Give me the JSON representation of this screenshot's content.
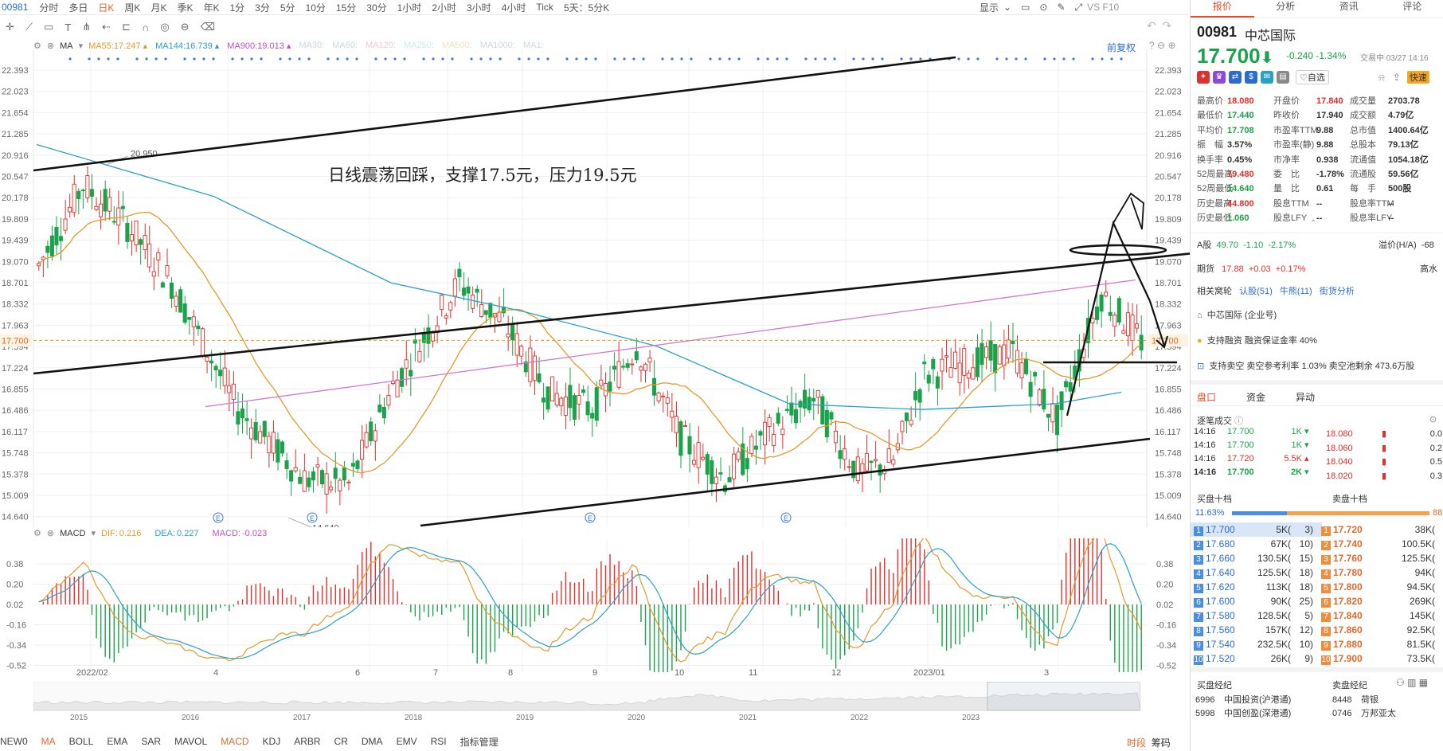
{
  "topbar": {
    "code": "00981",
    "periods": [
      "分时",
      "多日",
      "日K",
      "周K",
      "月K",
      "季K",
      "年K",
      "1分",
      "3分",
      "5分",
      "10分",
      "15分",
      "30分",
      "1小时",
      "2小时",
      "3小时",
      "4小时",
      "Tick",
      "5天：5分K"
    ],
    "active_period": "日K",
    "show_label": "显示",
    "vs_label": "VS F10"
  },
  "main_chart": {
    "indicator_name": "MA",
    "ma_items": [
      {
        "label": "MA55:",
        "value": "17.247",
        "color": "#e39a2c"
      },
      {
        "label": "MA144:",
        "value": "16.739",
        "color": "#2aa0c8"
      },
      {
        "label": "MA900:",
        "value": "19.013",
        "color": "#c050c0"
      },
      {
        "label": "MA30:",
        "value": "",
        "color": "#c8d8e8"
      },
      {
        "label": "MA60:",
        "value": "",
        "color": "#c8d8e8"
      },
      {
        "label": "MA120:",
        "value": "",
        "color": "#f0c8d8"
      },
      {
        "label": "MA250:",
        "value": "",
        "color": "#c8e8f0"
      },
      {
        "label": "MA500:",
        "value": "",
        "color": "#f0e0c0"
      },
      {
        "label": "MA1000:",
        "value": "",
        "color": "#c8d8e8"
      },
      {
        "label": "MA1:",
        "value": "",
        "color": "#c8d8e8"
      }
    ],
    "fq_label": "前复权",
    "annotation": "日线震荡回踩，支撑17.5元，压力19.5元",
    "high_label": "20.950",
    "low_label": "14.640",
    "current_price_tag": "17.700",
    "y_ticks": [
      "22.393",
      "22.023",
      "21.654",
      "21.285",
      "20.916",
      "20.547",
      "20.178",
      "19.809",
      "19.439",
      "19.070",
      "18.701",
      "18.332",
      "17.963",
      "17.594",
      "17.224",
      "16.855",
      "16.486",
      "16.117",
      "15.748",
      "15.378",
      "15.009",
      "14.640"
    ],
    "event_marker": "E"
  },
  "macd": {
    "name": "MACD",
    "dif_label": "DIF:",
    "dif_value": "0.216",
    "dea_label": "DEA:",
    "dea_value": "0.227",
    "macd_label": "MACD:",
    "macd_value": "-0.023",
    "y_ticks": [
      "0.38",
      "0.20",
      "0.02",
      "-0.16",
      "-0.34",
      "-0.52"
    ]
  },
  "x_axis": {
    "labels": [
      "2022/02",
      "4",
      "6",
      "7",
      "8",
      "9",
      "10",
      "11",
      "12",
      "2023/01",
      "3"
    ]
  },
  "overview": {
    "years": [
      "2015",
      "2016",
      "2017",
      "2018",
      "2019",
      "2020",
      "2021",
      "2022",
      "2023"
    ]
  },
  "bottom_tabs": {
    "items": [
      "NEW0",
      "MA",
      "BOLL",
      "EMA",
      "SAR",
      "MAVOL",
      "MACD",
      "KDJ",
      "ARBR",
      "CR",
      "DMA",
      "EMV",
      "RSI",
      "指标管理"
    ],
    "active": [
      "MA",
      "MACD"
    ],
    "right_items": [
      "时段",
      "筹码"
    ]
  },
  "quote": {
    "tabs": [
      "报价",
      "分析",
      "资讯",
      "评论"
    ],
    "code": "00981",
    "name": "中芯国际",
    "price": "17.700",
    "change": "-0.240",
    "pct": "-1.34%",
    "trade_status": "交易中 03/27 14:16",
    "add_watch": "自选",
    "quick_trade": "快速",
    "stats": [
      [
        "最高价",
        "18.080",
        "red"
      ],
      [
        "开盘价",
        "17.840",
        "red"
      ],
      [
        "成交量",
        "2703.78",
        ""
      ],
      [
        "最低价",
        "17.440",
        "grn"
      ],
      [
        "昨收价",
        "17.940",
        ""
      ],
      [
        "成交额",
        "4.79亿",
        ""
      ],
      [
        "平均价",
        "17.708",
        "grn"
      ],
      [
        "市盈率TTM",
        "9.88",
        ""
      ],
      [
        "总市值",
        "1400.64亿",
        ""
      ],
      [
        "振　幅",
        "3.57%",
        ""
      ],
      [
        "市盈率(静)",
        "9.88",
        ""
      ],
      [
        "总股本",
        "79.13亿",
        ""
      ],
      [
        "换手率",
        "0.45%",
        ""
      ],
      [
        "市净率",
        "0.938",
        ""
      ],
      [
        "流通值",
        "1054.18亿",
        ""
      ],
      [
        "52周最高",
        "19.480",
        "red"
      ],
      [
        "委　比",
        "-1.78%",
        ""
      ],
      [
        "流通股",
        "59.56亿",
        ""
      ],
      [
        "52周最低",
        "14.640",
        "grn"
      ],
      [
        "量　比",
        "0.61",
        ""
      ],
      [
        "每　手",
        "500股",
        ""
      ],
      [
        "历史最高",
        "44.800",
        "red"
      ],
      [
        "股息TTM",
        "--",
        ""
      ],
      [
        "股息率TTM",
        "--",
        ""
      ],
      [
        "历史最低",
        "1.060",
        "grn"
      ],
      [
        "股息LFY",
        "--",
        ""
      ],
      [
        "股息率LFY",
        "--",
        ""
      ]
    ],
    "a_share_label": "A股",
    "a_share_price": "49.70",
    "a_share_change": "-1.10",
    "a_share_pct": "-2.17%",
    "premium_label": "溢价(H/A)",
    "premium_value": "-68",
    "futures_label": "期货",
    "futures_price": "17.88",
    "futures_change": "+0.03",
    "futures_pct": "+0.17%",
    "futures_right": "高水",
    "warrants_label": "相关窝轮",
    "warrant_call": "认股(51)",
    "warrant_bull": "牛熊(11)",
    "warrant_street": "街货分析",
    "company_account": "中芯国际 (企业号)",
    "margin_text": "支持融资 融资保证金率 40%",
    "short_text": "支持卖空 卖空参考利率 1.03% 卖空池剩余 473.6万股",
    "depth_tabs": [
      "盘口",
      "资金",
      "异动"
    ],
    "tick_title": "逐笔成交",
    "ticks": [
      {
        "time": "14:16",
        "price": "17.700",
        "vol": "1K",
        "dir": "down"
      },
      {
        "time": "14:16",
        "price": "17.700",
        "vol": "1K",
        "dir": "down"
      },
      {
        "time": "14:16",
        "price": "17.720",
        "vol": "5.5K",
        "dir": "up"
      },
      {
        "time": "14:16",
        "price": "17.700",
        "vol": "2K",
        "dir": "down"
      }
    ],
    "price_ladder": [
      {
        "price": "18.080",
        "val": "0.0"
      },
      {
        "price": "18.060",
        "val": "0.2"
      },
      {
        "price": "18.040",
        "val": "0.5"
      },
      {
        "price": "18.020",
        "val": "0.3"
      }
    ],
    "bid_title": "买盘十档",
    "ask_title": "卖盘十档",
    "bid_ratio": "11.63%",
    "ask_ratio": "88",
    "bids": [
      {
        "n": "1",
        "price": "17.700",
        "vol": "5K(",
        "cnt": "3)"
      },
      {
        "n": "2",
        "price": "17.680",
        "vol": "67K(",
        "cnt": "10)"
      },
      {
        "n": "3",
        "price": "17.660",
        "vol": "130.5K(",
        "cnt": "15)"
      },
      {
        "n": "4",
        "price": "17.640",
        "vol": "125.5K(",
        "cnt": "18)"
      },
      {
        "n": "5",
        "price": "17.620",
        "vol": "113K(",
        "cnt": "18)"
      },
      {
        "n": "6",
        "price": "17.600",
        "vol": "90K(",
        "cnt": "25)"
      },
      {
        "n": "7",
        "price": "17.580",
        "vol": "128.5K(",
        "cnt": "5)"
      },
      {
        "n": "8",
        "price": "17.560",
        "vol": "157K(",
        "cnt": "12)"
      },
      {
        "n": "9",
        "price": "17.540",
        "vol": "232.5K(",
        "cnt": "10)"
      },
      {
        "n": "10",
        "price": "17.520",
        "vol": "26K(",
        "cnt": "9)"
      }
    ],
    "asks": [
      {
        "n": "1",
        "price": "17.720",
        "vol": "38K("
      },
      {
        "n": "2",
        "price": "17.740",
        "vol": "100.5K("
      },
      {
        "n": "3",
        "price": "17.760",
        "vol": "125.5K("
      },
      {
        "n": "4",
        "price": "17.780",
        "vol": "94K("
      },
      {
        "n": "5",
        "price": "17.800",
        "vol": "94.5K("
      },
      {
        "n": "6",
        "price": "17.820",
        "vol": "269K("
      },
      {
        "n": "7",
        "price": "17.840",
        "vol": "145K("
      },
      {
        "n": "8",
        "price": "17.860",
        "vol": "92.5K("
      },
      {
        "n": "9",
        "price": "17.880",
        "vol": "81.5K("
      },
      {
        "n": "10",
        "price": "17.900",
        "vol": "73.5K("
      }
    ],
    "buy_broker_title": "买盘经纪",
    "sell_broker_title": "卖盘经纪",
    "buy_brokers": [
      {
        "id": "6996",
        "name": "中国投资(沪港通)"
      },
      {
        "id": "5998",
        "name": "中国创盈(深港通)"
      }
    ],
    "sell_brokers": [
      {
        "id": "8448",
        "name": "荷银"
      },
      {
        "id": "0746",
        "name": "万邦亚太"
      }
    ]
  }
}
